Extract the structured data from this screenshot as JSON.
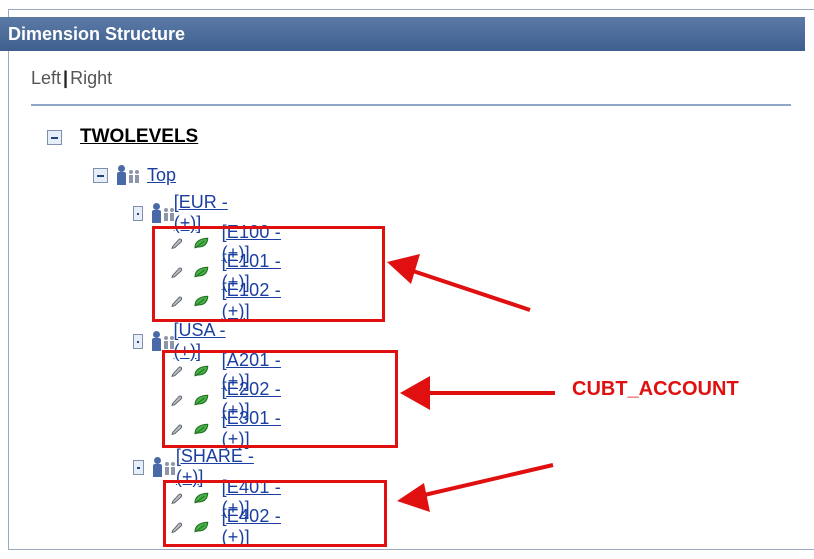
{
  "header": {
    "title": "Dimension Structure"
  },
  "tabs": {
    "left": "Left",
    "separator": "|",
    "right": "Right"
  },
  "tree": {
    "root": {
      "label": "TWOLEVELS"
    },
    "top": {
      "label": "Top"
    },
    "groups": [
      {
        "label": "[EUR - (+)]",
        "children": [
          "[E100 - (+)]",
          "[E101 - (+)]",
          "[E102 - (+)]"
        ]
      },
      {
        "label": "[USA - (+)]",
        "children": [
          "[A201 - (+)]",
          "[E202 - (+)]",
          "[E301 - (+)]"
        ]
      },
      {
        "label": "[SHARE - (+)]",
        "children": [
          "[E401 - (+)]",
          "[E402 - (+)]"
        ]
      }
    ]
  },
  "annotation": {
    "label": "CUBT_ACCOUNT",
    "color": "#e01010"
  },
  "icons": {
    "toggle": "collapse-icon",
    "node": "tree-node-icon",
    "pencil": "edit-pencil-icon",
    "leaf": "leaf-icon"
  }
}
